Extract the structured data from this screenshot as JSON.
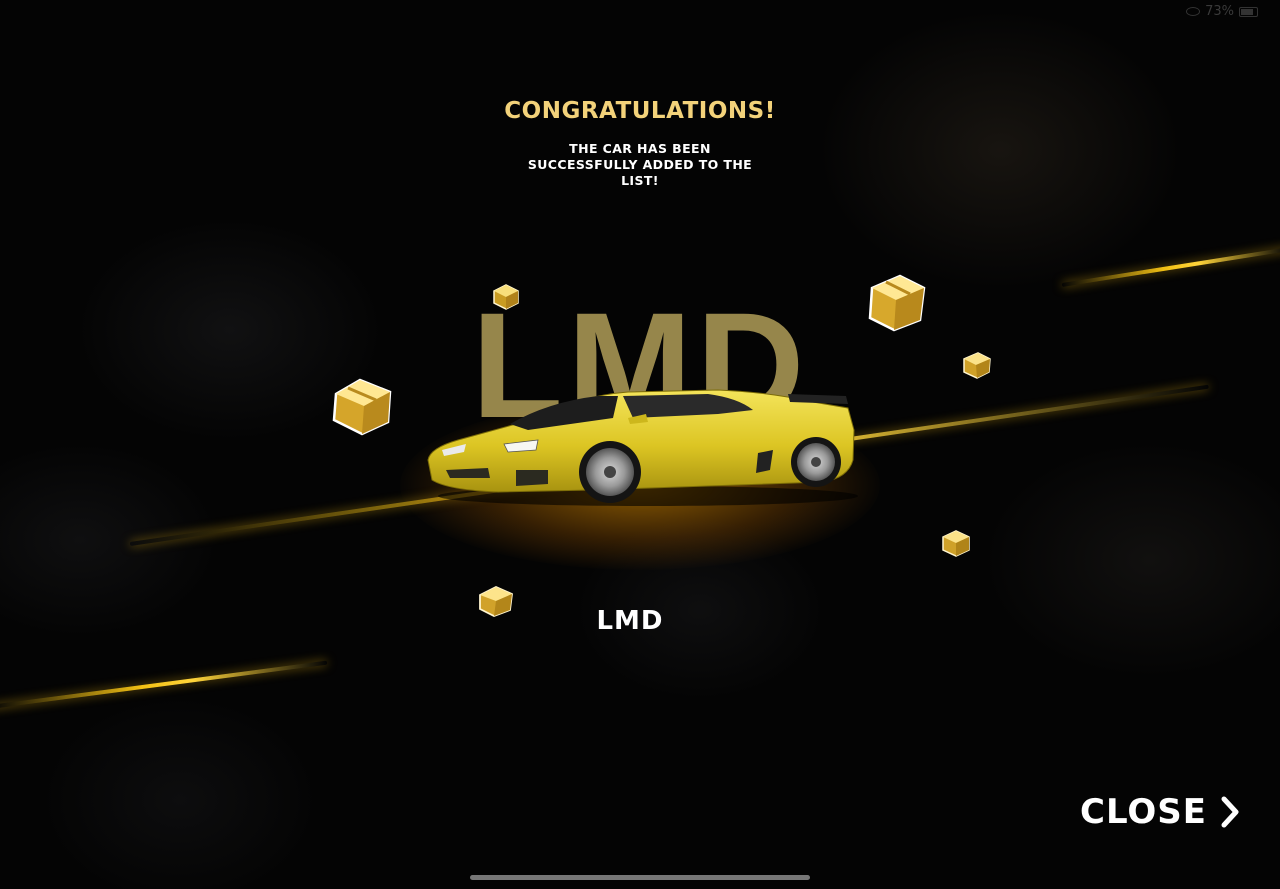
{
  "status_bar": {
    "battery_text": "73%",
    "icons": [
      "eye-icon",
      "battery-icon"
    ]
  },
  "dialog": {
    "title": "CONGRATULATIONS!",
    "message_line1": "THE CAR HAS BEEN",
    "message_line2": "SUCCESSFULLY ADDED TO THE",
    "message_line3": "LIST!",
    "background_code": "LMD",
    "car_name": "LMD",
    "close_label": "CLOSE",
    "close_icon": "chevron-right-icon"
  },
  "colors": {
    "accent": "#f3d27a",
    "streak": "#f2c014",
    "car_body": "#e6cf2a",
    "background": "#040404",
    "text": "#ffffff"
  }
}
